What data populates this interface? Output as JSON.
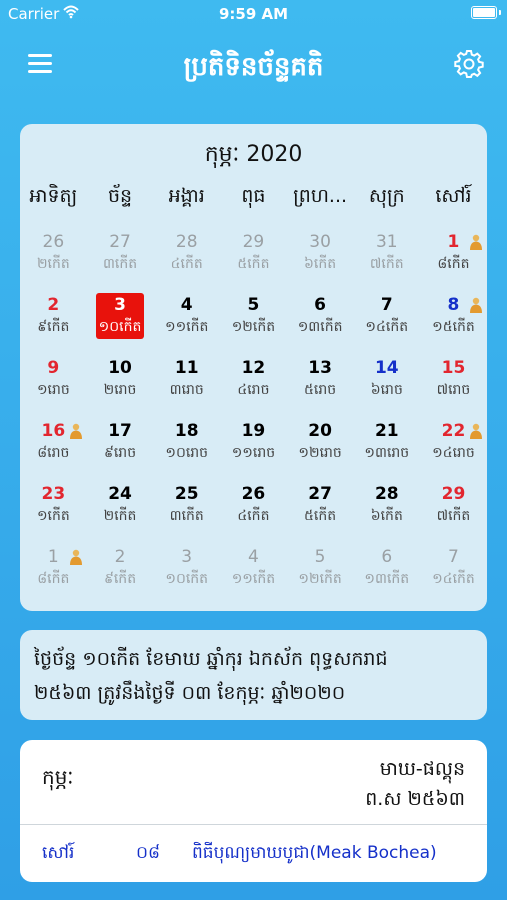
{
  "status_bar": {
    "carrier": "Carrier",
    "time": "9:59 AM"
  },
  "header": {
    "title": "ប្រតិទិនច័ន្ទគតិ",
    "menu_icon": "hamburger-menu-icon",
    "settings_icon": "gear-icon"
  },
  "calendar": {
    "month_title": "កុម្ភៈ 2020",
    "weekdays": [
      "អាទិត្យ",
      "ច័ន្ទ",
      "អង្គារ",
      "ពុធ",
      "ព្រហ...",
      "សុក្រ",
      "សៅរ៍"
    ],
    "weeks": [
      [
        {
          "num": "26",
          "lunar": "២កើត",
          "out": true
        },
        {
          "num": "27",
          "lunar": "៣កើត",
          "out": true
        },
        {
          "num": "28",
          "lunar": "៤កើត",
          "out": true
        },
        {
          "num": "29",
          "lunar": "៥កើត",
          "out": true
        },
        {
          "num": "30",
          "lunar": "៦កើត",
          "out": true
        },
        {
          "num": "31",
          "lunar": "៧កើត",
          "out": true
        },
        {
          "num": "1",
          "lunar": "៨កើត",
          "monk": true,
          "red": true
        }
      ],
      [
        {
          "num": "2",
          "lunar": "៩កើត",
          "red": true
        },
        {
          "num": "3",
          "lunar": "១០កើត",
          "today": true
        },
        {
          "num": "4",
          "lunar": "១១កើត"
        },
        {
          "num": "5",
          "lunar": "១២កើត"
        },
        {
          "num": "6",
          "lunar": "១៣កើត"
        },
        {
          "num": "7",
          "lunar": "១៤កើត"
        },
        {
          "num": "8",
          "lunar": "១៥កើត",
          "monk": true,
          "blue": true
        }
      ],
      [
        {
          "num": "9",
          "lunar": "១រោច",
          "red": true
        },
        {
          "num": "10",
          "lunar": "២រោច"
        },
        {
          "num": "11",
          "lunar": "៣រោច"
        },
        {
          "num": "12",
          "lunar": "៤រោច"
        },
        {
          "num": "13",
          "lunar": "៥រោច"
        },
        {
          "num": "14",
          "lunar": "៦រោច",
          "blue": true
        },
        {
          "num": "15",
          "lunar": "៧រោច",
          "red": true
        }
      ],
      [
        {
          "num": "16",
          "lunar": "៨រោច",
          "red": true,
          "monk": true
        },
        {
          "num": "17",
          "lunar": "៩រោច"
        },
        {
          "num": "18",
          "lunar": "១០រោច"
        },
        {
          "num": "19",
          "lunar": "១១រោច"
        },
        {
          "num": "20",
          "lunar": "១២រោច"
        },
        {
          "num": "21",
          "lunar": "១៣រោច"
        },
        {
          "num": "22",
          "lunar": "១៤រោច",
          "red": true,
          "monk": true
        }
      ],
      [
        {
          "num": "23",
          "lunar": "១កើត",
          "red": true
        },
        {
          "num": "24",
          "lunar": "២កើត"
        },
        {
          "num": "25",
          "lunar": "៣កើត"
        },
        {
          "num": "26",
          "lunar": "៤កើត"
        },
        {
          "num": "27",
          "lunar": "៥កើត"
        },
        {
          "num": "28",
          "lunar": "៦កើត"
        },
        {
          "num": "29",
          "lunar": "៧កើត",
          "red": true
        }
      ],
      [
        {
          "num": "1",
          "lunar": "៨កើត",
          "out": true,
          "monk": true
        },
        {
          "num": "2",
          "lunar": "៩កើត",
          "out": true
        },
        {
          "num": "3",
          "lunar": "១០កើត",
          "out": true
        },
        {
          "num": "4",
          "lunar": "១១កើត",
          "out": true
        },
        {
          "num": "5",
          "lunar": "១២កើត",
          "out": true
        },
        {
          "num": "6",
          "lunar": "១៣កើត",
          "out": true
        },
        {
          "num": "7",
          "lunar": "១៤កើត",
          "out": true
        }
      ]
    ]
  },
  "info": {
    "line1": "ថ្ងៃច័ន្ទ ១០កើត ខែមាឃ ឆ្នាំកុរ ឯកស័ក ពុទ្ធសករាជ",
    "line2": "២៥៦៣ ត្រូវនឹងថ្ងៃទី ០៣ ខែកុម្ភៈ ឆ្នាំ២០២០"
  },
  "events": {
    "month": "កុម្ភៈ",
    "khmer_month": "មាឃ-ផល្គុន",
    "khmer_year": "ព.ស ២៥៦៣",
    "items": [
      {
        "day": "សៅរ៍",
        "date": "០៨",
        "name": "ពិធីបុណ្យមាឃបូជា(Meak Bochea)"
      }
    ]
  },
  "colors": {
    "accent": "#2f9fe6",
    "today": "#e8120c",
    "holiday_red": "#e2262f",
    "holiday_blue": "#1530c9"
  }
}
